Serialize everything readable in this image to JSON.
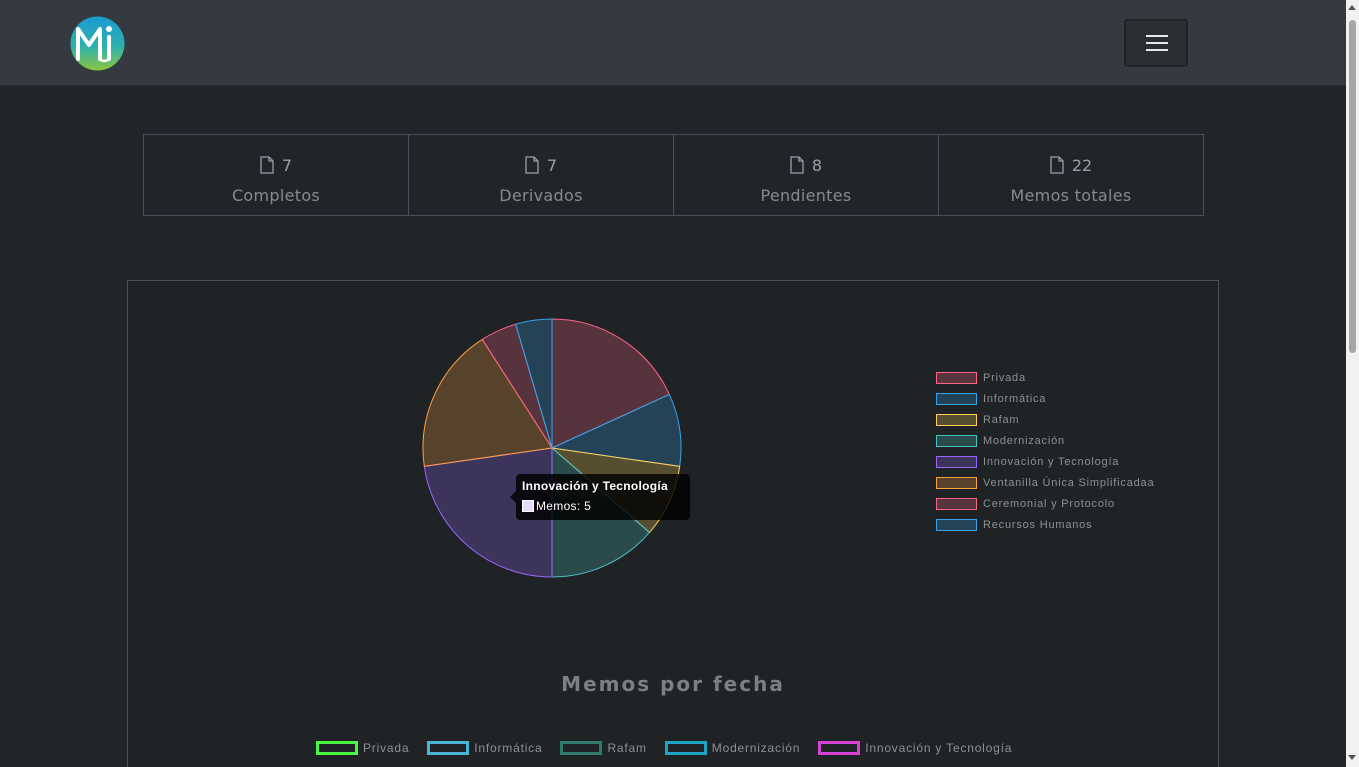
{
  "brand": {
    "logo_icon": "mi-logo"
  },
  "nav": {
    "toggle_icon": "hamburger-icon"
  },
  "stats": [
    {
      "icon": "file-icon",
      "value": "7",
      "label": "Completos"
    },
    {
      "icon": "file-icon",
      "value": "7",
      "label": "Derivados"
    },
    {
      "icon": "file-icon",
      "value": "8",
      "label": "Pendientes"
    },
    {
      "icon": "file-icon",
      "value": "22",
      "label": "Memos totales"
    }
  ],
  "chart_data": [
    {
      "type": "pie",
      "title": "",
      "categories": [
        "Privada",
        "Informática",
        "Rafam",
        "Modernización",
        "Innovación y Tecnología",
        "Ventanilla Única Simplificadaa",
        "Ceremonial y Protocolo",
        "Recursos Humanos"
      ],
      "values": [
        4,
        2,
        2,
        3,
        5,
        4,
        1,
        1
      ],
      "colors": [
        "#ff6384",
        "#36a2eb",
        "#ffce56",
        "#4bc0c0",
        "#9966ff",
        "#ff9f40",
        "#ff6384",
        "#36a2eb"
      ],
      "legend_position": "right",
      "tooltip": {
        "title": "Innovación y Tecnología",
        "label": "Memos",
        "value": "5"
      }
    },
    {
      "type": "line",
      "title": "Memos por fecha",
      "series": [
        {
          "name": "Privada",
          "color": "#4cf542"
        },
        {
          "name": "Informática",
          "color": "#4bb4d6"
        },
        {
          "name": "Rafam",
          "color": "#2f7a6a"
        },
        {
          "name": "Modernización",
          "color": "#1fa3c4"
        },
        {
          "name": "Innovación y Tecnología",
          "color": "#d642d6"
        }
      ],
      "legend_position": "top"
    }
  ]
}
